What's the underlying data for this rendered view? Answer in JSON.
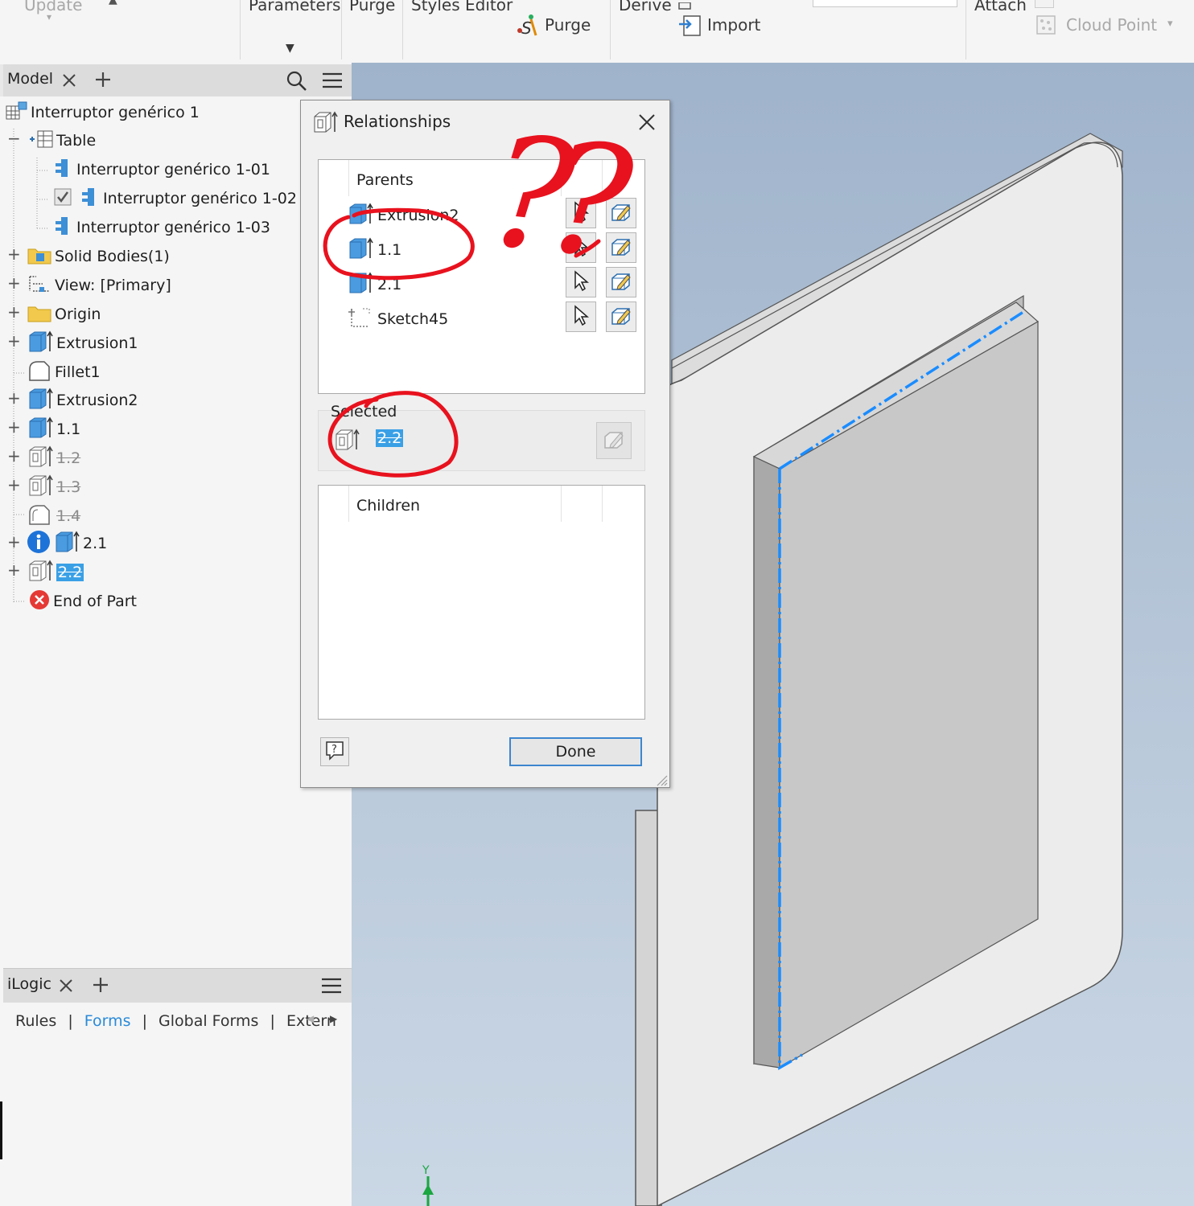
{
  "ribbon": {
    "update": "Update",
    "parameters": "Parameters",
    "purge_top": "Purge",
    "styles_editor": "Styles Editor",
    "purge": "Purge",
    "derive": "Derive",
    "import": "Import",
    "attach": "Attach",
    "cloud_point": "Cloud Point"
  },
  "browser": {
    "tab_label": "Model",
    "tree": [
      {
        "label": "Interruptor genérico 1"
      },
      {
        "label": "Table"
      },
      {
        "label": "Interruptor genérico 1-01"
      },
      {
        "label": "Interruptor genérico 1-02"
      },
      {
        "label": "Interruptor genérico 1-03"
      },
      {
        "label": "Solid Bodies(1)"
      },
      {
        "label": "View: [Primary]"
      },
      {
        "label": "Origin"
      },
      {
        "label": "Extrusion1"
      },
      {
        "label": "Fillet1"
      },
      {
        "label": "Extrusion2"
      },
      {
        "label": "1.1"
      },
      {
        "label": "1.2"
      },
      {
        "label": "1.3"
      },
      {
        "label": "1.4"
      },
      {
        "label": "2.1"
      },
      {
        "label": "2.2"
      },
      {
        "label": "End of Part"
      }
    ]
  },
  "ilogic": {
    "tab_label": "iLogic",
    "tabs": [
      "Rules",
      "Forms",
      "Global Forms",
      "Extern"
    ]
  },
  "dialog": {
    "title": "Relationships",
    "parents_header": "Parents",
    "parents": [
      {
        "label": "Extrusion2"
      },
      {
        "label": "1.1"
      },
      {
        "label": "2.1"
      },
      {
        "label": "Sketch45"
      }
    ],
    "selected_header": "Selected",
    "selected_label": "2.2",
    "children_header": "Children",
    "done_label": "Done"
  },
  "annotation": {
    "text": "??"
  },
  "viewport": {
    "axis_label": "Y"
  },
  "colors": {
    "accent": "#3aa0e6",
    "annotation": "#e8121e",
    "face_light": "#ececec",
    "face_inner": "#c8c8c8"
  }
}
